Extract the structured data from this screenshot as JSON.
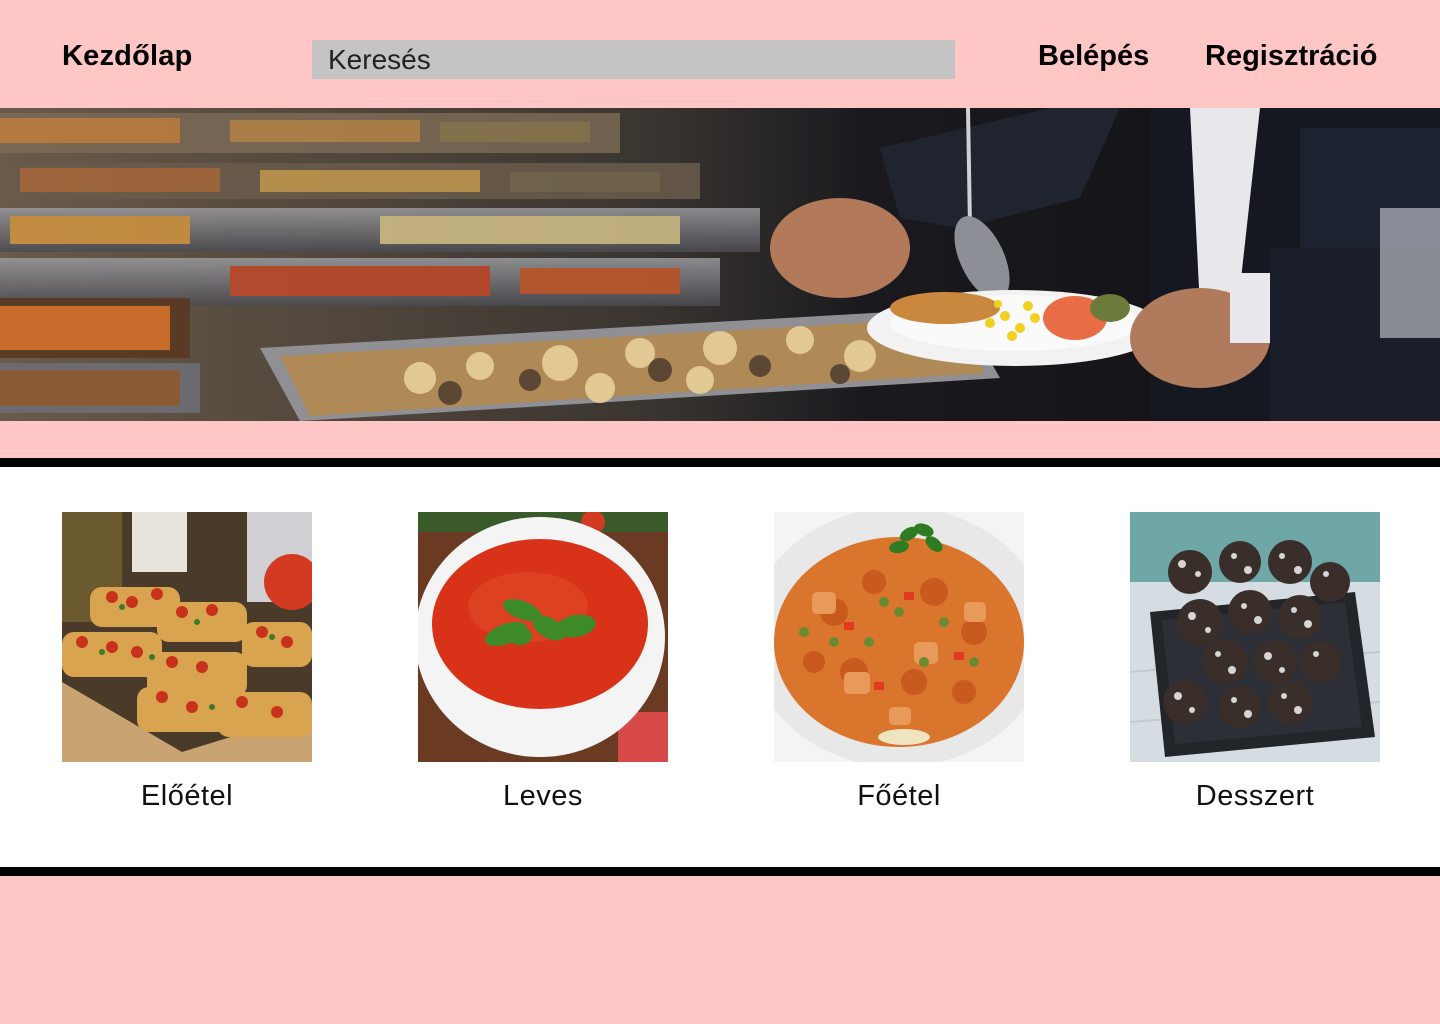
{
  "header": {
    "home_label": "Kezdőlap",
    "search_placeholder": "Keresés",
    "login_label": "Belépés",
    "register_label": "Regisztráció"
  },
  "hero": {
    "image": "buffet-serving-photo"
  },
  "categories": [
    {
      "label": "Előétel",
      "image": "bruschetta-photo"
    },
    {
      "label": "Leves",
      "image": "tomato-soup-photo"
    },
    {
      "label": "Főétel",
      "image": "rice-dish-photo"
    },
    {
      "label": "Desszert",
      "image": "coconut-balls-photo"
    }
  ],
  "colors": {
    "background": "#ffc6c6",
    "search_field": "#c4c4c4",
    "divider": "#000000",
    "category_band": "#ffffff"
  }
}
